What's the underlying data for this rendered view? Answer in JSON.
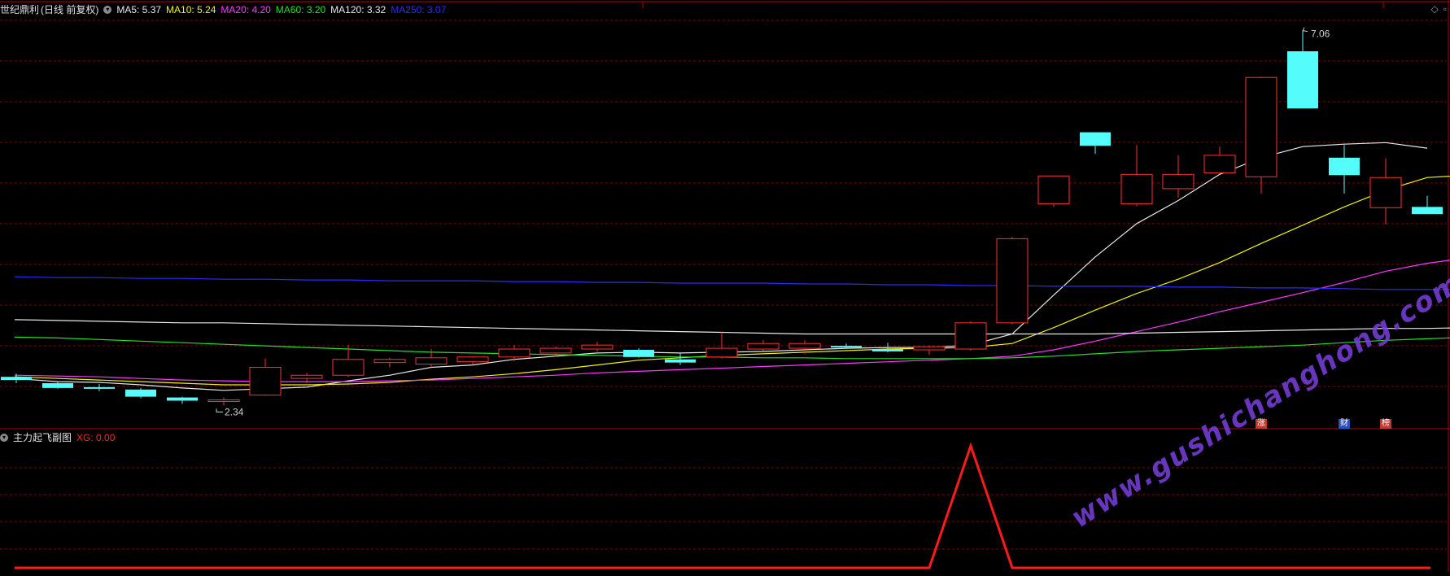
{
  "header": {
    "stock_name": "世纪鼎利",
    "period_label": "(日线 前复权)",
    "ma_indicators": [
      {
        "label": "MA5: 5.37",
        "color": "#e8e8e8"
      },
      {
        "label": "MA10: 5.24",
        "color": "#f2f20a"
      },
      {
        "label": "MA20: 4.20",
        "color": "#ff36ff"
      },
      {
        "label": "MA60: 3.20",
        "color": "#24e024"
      },
      {
        "label": "MA120: 3.32",
        "color": "#e8e8e8"
      },
      {
        "label": "MA250: 3.07",
        "color": "#2a2aff"
      }
    ]
  },
  "sub_header": {
    "indicator_name": "主力起飞副图",
    "value_label": "XG: 0.00",
    "value_color": "#ff2020"
  },
  "markers": {
    "high_label": "7.06",
    "low_label": "2.34"
  },
  "event_tags": [
    {
      "text": "涨",
      "bar_index": 30,
      "bg": "#c0392b"
    },
    {
      "text": "财",
      "bar_index": 32,
      "bg": "#2a4dbf"
    },
    {
      "text": "榜",
      "bar_index": 33,
      "bg": "#c0392b"
    }
  ],
  "watermark": "www.gushichanghong.com",
  "colors": {
    "up": "#ff3030",
    "down": "#54fcfc",
    "grid": "#8a0000"
  },
  "chart_data": {
    "type": "candlestick",
    "price_range": [
      2.2,
      7.2
    ],
    "candles": [
      {
        "o": 2.7,
        "h": 2.74,
        "l": 2.62,
        "c": 2.66
      },
      {
        "o": 2.62,
        "h": 2.64,
        "l": 2.55,
        "c": 2.56
      },
      {
        "o": 2.57,
        "h": 2.61,
        "l": 2.52,
        "c": 2.56
      },
      {
        "o": 2.54,
        "h": 2.56,
        "l": 2.43,
        "c": 2.45
      },
      {
        "o": 2.44,
        "h": 2.45,
        "l": 2.36,
        "c": 2.4
      },
      {
        "o": 2.4,
        "h": 2.44,
        "l": 2.34,
        "c": 2.41
      },
      {
        "o": 2.47,
        "h": 2.93,
        "l": 2.46,
        "c": 2.82
      },
      {
        "o": 2.68,
        "h": 2.75,
        "l": 2.62,
        "c": 2.72
      },
      {
        "o": 2.72,
        "h": 3.1,
        "l": 2.7,
        "c": 2.92
      },
      {
        "o": 2.88,
        "h": 2.94,
        "l": 2.82,
        "c": 2.92
      },
      {
        "o": 2.86,
        "h": 3.05,
        "l": 2.82,
        "c": 2.94
      },
      {
        "o": 2.89,
        "h": 2.96,
        "l": 2.85,
        "c": 2.95
      },
      {
        "o": 2.95,
        "h": 3.1,
        "l": 2.9,
        "c": 3.05
      },
      {
        "o": 3.0,
        "h": 3.08,
        "l": 2.96,
        "c": 3.06
      },
      {
        "o": 3.05,
        "h": 3.14,
        "l": 3.02,
        "c": 3.1
      },
      {
        "o": 3.04,
        "h": 3.06,
        "l": 2.94,
        "c": 2.95
      },
      {
        "o": 2.92,
        "h": 3.0,
        "l": 2.85,
        "c": 2.88
      },
      {
        "o": 2.95,
        "h": 3.26,
        "l": 2.93,
        "c": 3.06
      },
      {
        "o": 3.05,
        "h": 3.16,
        "l": 3.03,
        "c": 3.12
      },
      {
        "o": 3.06,
        "h": 3.16,
        "l": 2.99,
        "c": 3.12
      },
      {
        "o": 3.09,
        "h": 3.12,
        "l": 3.06,
        "c": 3.07
      },
      {
        "o": 3.05,
        "h": 3.13,
        "l": 3.01,
        "c": 3.02
      },
      {
        "o": 3.04,
        "h": 3.09,
        "l": 2.98,
        "c": 3.08
      },
      {
        "o": 3.05,
        "h": 3.4,
        "l": 3.03,
        "c": 3.38
      },
      {
        "o": 3.38,
        "h": 4.46,
        "l": 3.36,
        "c": 4.44
      },
      {
        "o": 4.88,
        "h": 4.9,
        "l": 4.84,
        "c": 5.23
      },
      {
        "o": 5.78,
        "h": 5.78,
        "l": 5.51,
        "c": 5.61
      },
      {
        "o": 4.88,
        "h": 5.62,
        "l": 4.85,
        "c": 5.25
      },
      {
        "o": 5.07,
        "h": 5.49,
        "l": 4.96,
        "c": 5.25
      },
      {
        "o": 5.27,
        "h": 5.6,
        "l": 5.26,
        "c": 5.49
      },
      {
        "o": 5.22,
        "h": 6.48,
        "l": 5.01,
        "c": 6.47
      },
      {
        "o": 6.8,
        "h": 7.06,
        "l": 6.08,
        "c": 6.08
      },
      {
        "o": 5.46,
        "h": 5.62,
        "l": 5.01,
        "c": 5.24
      },
      {
        "o": 4.83,
        "h": 5.45,
        "l": 4.62,
        "c": 5.21
      },
      {
        "o": 4.84,
        "h": 4.98,
        "l": 4.75,
        "c": 4.75
      }
    ],
    "ma_lines": [
      {
        "name": "MA5",
        "color": "#e8e8e8",
        "values": [
          2.68,
          2.64,
          2.63,
          2.6,
          2.56,
          2.53,
          2.55,
          2.57,
          2.65,
          2.72,
          2.82,
          2.85,
          2.92,
          2.96,
          3.0,
          3.01,
          3.0,
          3.01,
          3.02,
          3.04,
          3.06,
          3.07,
          3.07,
          3.1,
          3.24,
          3.73,
          4.21,
          4.63,
          4.92,
          5.25,
          5.46,
          5.6,
          5.63,
          5.65,
          5.58
        ]
      },
      {
        "name": "MA10",
        "color": "#f2f20a",
        "values": [
          2.7,
          2.68,
          2.66,
          2.64,
          2.62,
          2.6,
          2.6,
          2.6,
          2.61,
          2.63,
          2.67,
          2.7,
          2.74,
          2.79,
          2.85,
          2.91,
          2.94,
          2.97,
          2.99,
          3.01,
          3.03,
          3.05,
          3.06,
          3.07,
          3.12,
          3.32,
          3.54,
          3.75,
          3.93,
          4.14,
          4.38,
          4.61,
          4.84,
          5.05,
          5.21,
          5.24
        ]
      },
      {
        "name": "MA20",
        "color": "#ff36ff",
        "values": [
          2.72,
          2.71,
          2.7,
          2.68,
          2.66,
          2.65,
          2.64,
          2.64,
          2.64,
          2.65,
          2.66,
          2.68,
          2.7,
          2.72,
          2.75,
          2.77,
          2.79,
          2.81,
          2.83,
          2.85,
          2.87,
          2.89,
          2.91,
          2.93,
          2.96,
          3.04,
          3.15,
          3.27,
          3.39,
          3.52,
          3.64,
          3.76,
          3.89,
          4.03,
          4.13,
          4.2
        ]
      },
      {
        "name": "MA60",
        "color": "#24e024",
        "values": [
          3.2,
          3.19,
          3.17,
          3.15,
          3.13,
          3.11,
          3.09,
          3.07,
          3.05,
          3.03,
          3.01,
          3.0,
          2.99,
          2.98,
          2.97,
          2.96,
          2.95,
          2.95,
          2.94,
          2.94,
          2.93,
          2.93,
          2.93,
          2.93,
          2.94,
          2.96,
          2.99,
          3.02,
          3.04,
          3.06,
          3.08,
          3.1,
          3.13,
          3.16,
          3.18,
          3.2
        ]
      },
      {
        "name": "MA120",
        "color": "#e8e8e8",
        "values": [
          3.42,
          3.41,
          3.4,
          3.39,
          3.38,
          3.38,
          3.37,
          3.36,
          3.35,
          3.34,
          3.33,
          3.32,
          3.31,
          3.3,
          3.29,
          3.28,
          3.27,
          3.26,
          3.25,
          3.24,
          3.24,
          3.24,
          3.24,
          3.24,
          3.24,
          3.24,
          3.24,
          3.25,
          3.26,
          3.27,
          3.28,
          3.29,
          3.3,
          3.31,
          3.31,
          3.32
        ]
      },
      {
        "name": "MA250",
        "color": "#2a2aff",
        "values": [
          3.96,
          3.95,
          3.95,
          3.94,
          3.94,
          3.93,
          3.93,
          3.92,
          3.92,
          3.91,
          3.91,
          3.91,
          3.9,
          3.9,
          3.89,
          3.89,
          3.88,
          3.88,
          3.88,
          3.87,
          3.87,
          3.86,
          3.86,
          3.85,
          3.85,
          3.84,
          3.84,
          3.84,
          3.83,
          3.83,
          3.82,
          3.82,
          3.81,
          3.8,
          3.8,
          3.8
        ]
      }
    ],
    "xg_values": [
      0,
      0,
      0,
      0,
      0,
      0,
      0,
      0,
      0,
      0,
      0,
      0,
      0,
      0,
      0,
      0,
      0,
      0,
      0,
      0,
      0,
      0,
      0,
      1,
      0,
      0,
      0,
      0,
      0,
      0,
      0,
      0,
      0,
      0,
      0,
      0
    ]
  }
}
